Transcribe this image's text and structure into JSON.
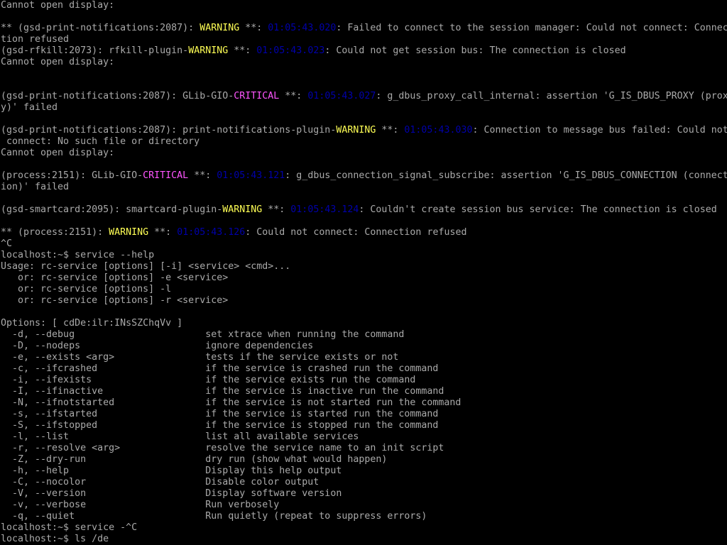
{
  "colors": {
    "background": "#000000",
    "text": "#aaaaaa",
    "warning": "#ffff55",
    "critical": "#ff55ff",
    "timestamp": "#0000aa"
  },
  "lines": [
    [
      {
        "t": "Cannot open display:"
      }
    ],
    [],
    [
      {
        "t": "** (gsd-print-notifications:2087): "
      },
      {
        "t": "WARNING",
        "s": "warn"
      },
      {
        "t": " **: "
      },
      {
        "t": "01:05:43.020",
        "s": "time"
      },
      {
        "t": ": Failed to connect to the session manager: Could not connect: Connec"
      }
    ],
    [
      {
        "t": "tion refused"
      }
    ],
    [
      {
        "t": "(gsd-rfkill:2073): rfkill-plugin-"
      },
      {
        "t": "WARNING",
        "s": "warn"
      },
      {
        "t": " **: "
      },
      {
        "t": "01:05:43.023",
        "s": "time"
      },
      {
        "t": ": Could not get session bus: The connection is closed"
      }
    ],
    [
      {
        "t": "Cannot open display:"
      }
    ],
    [],
    [],
    [
      {
        "t": "(gsd-print-notifications:2087): GLib-GIO-"
      },
      {
        "t": "CRITICAL",
        "s": "crit"
      },
      {
        "t": " **: "
      },
      {
        "t": "01:05:43.027",
        "s": "time"
      },
      {
        "t": ": g_dbus_proxy_call_internal: assertion 'G_IS_DBUS_PROXY (prox"
      }
    ],
    [
      {
        "t": "y)' failed"
      }
    ],
    [],
    [
      {
        "t": "(gsd-print-notifications:2087): print-notifications-plugin-"
      },
      {
        "t": "WARNING",
        "s": "warn"
      },
      {
        "t": " **: "
      },
      {
        "t": "01:05:43.030",
        "s": "time"
      },
      {
        "t": ": Connection to message bus failed: Could not"
      }
    ],
    [
      {
        "t": " connect: No such file or directory"
      }
    ],
    [
      {
        "t": "Cannot open display:"
      }
    ],
    [],
    [
      {
        "t": "(process:2151): GLib-GIO-"
      },
      {
        "t": "CRITICAL",
        "s": "crit"
      },
      {
        "t": " **: "
      },
      {
        "t": "01:05:43.121",
        "s": "time"
      },
      {
        "t": ": g_dbus_connection_signal_subscribe: assertion 'G_IS_DBUS_CONNECTION (connect"
      }
    ],
    [
      {
        "t": "ion)' failed"
      }
    ],
    [],
    [
      {
        "t": "(gsd-smartcard:2095): smartcard-plugin-"
      },
      {
        "t": "WARNING",
        "s": "warn"
      },
      {
        "t": " **: "
      },
      {
        "t": "01:05:43.124",
        "s": "time"
      },
      {
        "t": ": Couldn't create session bus service: The connection is closed"
      }
    ],
    [],
    [
      {
        "t": "** (process:2151): "
      },
      {
        "t": "WARNING",
        "s": "warn"
      },
      {
        "t": " **: "
      },
      {
        "t": "01:05:43.126",
        "s": "time"
      },
      {
        "t": ": Could not connect: Connection refused"
      }
    ],
    [
      {
        "t": "^C"
      }
    ],
    [
      {
        "t": "localhost:~$ service --help"
      }
    ],
    [
      {
        "t": "Usage: rc-service [options] [-i] <service> <cmd>..."
      }
    ],
    [
      {
        "t": "   or: rc-service [options] -e <service>"
      }
    ],
    [
      {
        "t": "   or: rc-service [options] -l"
      }
    ],
    [
      {
        "t": "   or: rc-service [options] -r <service>"
      }
    ],
    [],
    [
      {
        "t": "Options: [ cdDe:ilr:INsSZChqVv ]"
      }
    ],
    [
      {
        "t": "  -d, --debug                       set xtrace when running the command"
      }
    ],
    [
      {
        "t": "  -D, --nodeps                      ignore dependencies"
      }
    ],
    [
      {
        "t": "  -e, --exists <arg>                tests if the service exists or not"
      }
    ],
    [
      {
        "t": "  -c, --ifcrashed                   if the service is crashed run the command"
      }
    ],
    [
      {
        "t": "  -i, --ifexists                    if the service exists run the command"
      }
    ],
    [
      {
        "t": "  -I, --ifinactive                  if the service is inactive run the command"
      }
    ],
    [
      {
        "t": "  -N, --ifnotstarted                if the service is not started run the command"
      }
    ],
    [
      {
        "t": "  -s, --ifstarted                   if the service is started run the command"
      }
    ],
    [
      {
        "t": "  -S, --ifstopped                   if the service is stopped run the command"
      }
    ],
    [
      {
        "t": "  -l, --list                        list all available services"
      }
    ],
    [
      {
        "t": "  -r, --resolve <arg>               resolve the service name to an init script"
      }
    ],
    [
      {
        "t": "  -Z, --dry-run                     dry run (show what would happen)"
      }
    ],
    [
      {
        "t": "  -h, --help                        Display this help output"
      }
    ],
    [
      {
        "t": "  -C, --nocolor                     Disable color output"
      }
    ],
    [
      {
        "t": "  -V, --version                     Display software version"
      }
    ],
    [
      {
        "t": "  -v, --verbose                     Run verbosely"
      }
    ],
    [
      {
        "t": "  -q, --quiet                       Run quietly (repeat to suppress errors)"
      }
    ],
    [
      {
        "t": "localhost:~$ service -^C"
      }
    ],
    [
      {
        "t": "localhost:~$ ls /de"
      }
    ]
  ]
}
